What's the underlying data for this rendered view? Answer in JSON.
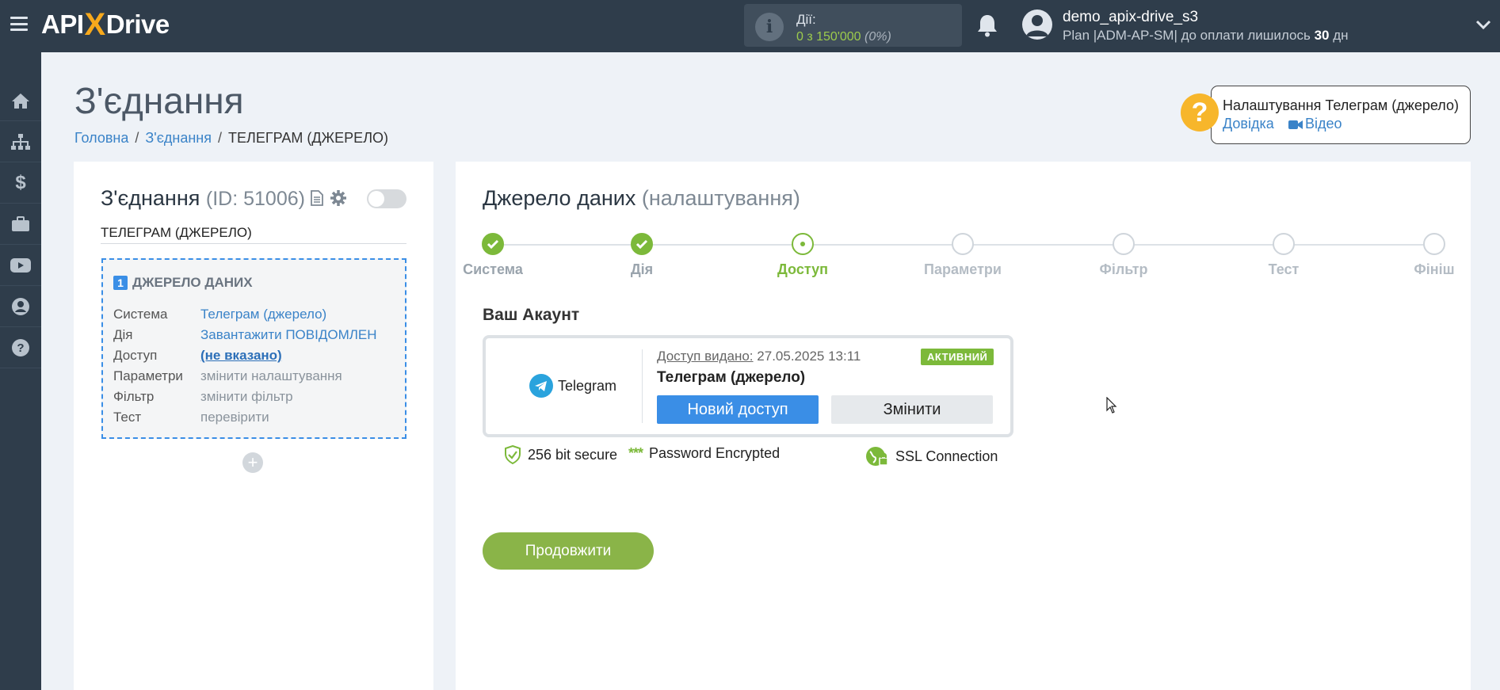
{
  "topbar": {
    "logo_left": "API",
    "logo_x": "X",
    "logo_right": "Drive",
    "actions_label": "Дії:",
    "actions_value": "0 з 150'000",
    "actions_percent": "(0%)",
    "user_name": "demo_apix-drive_s3",
    "plan_prefix": "Plan |ADM-AP-SM| до оплати лишилось",
    "plan_days": "30",
    "plan_suffix": "дн"
  },
  "sidebar": {
    "items": [
      "home-icon",
      "sitemap-icon",
      "dollar-icon",
      "briefcase-icon",
      "youtube-icon",
      "user-circle-icon",
      "question-icon"
    ]
  },
  "page": {
    "title": "З'єднання",
    "breadcrumb": [
      "Головна",
      "З'єднання",
      "ТЕЛЕГРАМ (ДЖЕРЕЛО)"
    ]
  },
  "help": {
    "title": "Налаштування Телеграм (джерело)",
    "docs_label": "Довідка",
    "video_label": "Відео"
  },
  "left_card": {
    "title": "З'єднання",
    "id_text": "(ID: 51006)",
    "subtitle": "ТЕЛЕГРАМ (ДЖЕРЕЛО)",
    "source_num": "1",
    "source_heading": "ДЖЕРЕЛО ДАНИХ",
    "rows": [
      {
        "key": "Система",
        "value": "Телеграм (джерело)"
      },
      {
        "key": "Дія",
        "value": "Завантажити ПОВІДОМЛЕН"
      },
      {
        "key": "Доступ",
        "value": "(не вказано)"
      },
      {
        "key": "Параметри",
        "value": "змінити налаштування"
      },
      {
        "key": "Фільтр",
        "value": "змінити фільтр"
      },
      {
        "key": "Тест",
        "value": "перевірити"
      }
    ],
    "add_symbol": "+"
  },
  "right_card": {
    "title": "Джерело даних",
    "title_paren": "(налаштування)",
    "steps": [
      "Система",
      "Дія",
      "Доступ",
      "Параметри",
      "Фільтр",
      "Тест",
      "Фініш"
    ],
    "account_label": "Ваш Акаунт",
    "telegram_logo_text": "Telegram",
    "access_label": "Доступ видано:",
    "access_date": "27.05.2025 13:11",
    "status_badge": "АКТИВНИЙ",
    "account_name": "Телеграм (джерело)",
    "new_access_btn": "Новий доступ",
    "change_btn": "Змінити",
    "security": [
      "256 bit secure",
      "Password Encrypted",
      "SSL Connection"
    ],
    "continue_btn": "Продовжити"
  },
  "colors": {
    "topbar": "#2f3d4b",
    "accent_green": "#7cb93a",
    "accent_blue": "#3a8ee6",
    "logo_x": "#f7a91c",
    "help_yellow": "#f7b62b"
  }
}
